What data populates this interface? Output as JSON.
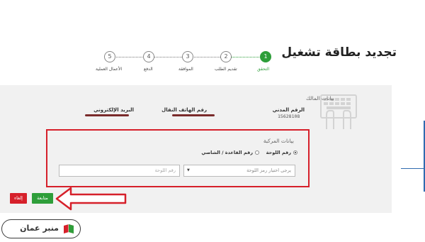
{
  "page": {
    "title": "تجديد بطاقة تشغيل"
  },
  "steps": [
    {
      "number": "1",
      "label": "التحقق",
      "active": true
    },
    {
      "number": "2",
      "label": "تقديم الطلب",
      "active": false
    },
    {
      "number": "3",
      "label": "الموافقة",
      "active": false
    },
    {
      "number": "4",
      "label": "الدفع",
      "active": false
    },
    {
      "number": "5",
      "label": "الأعمال العملية",
      "active": false
    }
  ],
  "owner": {
    "section_title": "بيانات المالك",
    "civil_label": "الرقم المدني",
    "civil_value": "15628108",
    "phone_label": "رقم الهاتف النقال",
    "email_label": "البريد الإلكتروني"
  },
  "vehicle": {
    "section_title": "بيانات المركبة",
    "radio_plate_label": "رقم اللوحة",
    "radio_chassis_label": "رقم القاعدة / الشاصي",
    "select_placeholder": "يرجى اختيار رمز اللوحة",
    "plate_input_placeholder": "رقم اللوحة"
  },
  "buttons": {
    "next_label": "متابعة",
    "cancel_label": "إلغاء"
  },
  "logo": {
    "text": "منبر عمان"
  },
  "colors": {
    "accent_green": "#2e9e3a",
    "highlight_red": "#d6202a",
    "right_line_blue": "#2f6bb0"
  }
}
